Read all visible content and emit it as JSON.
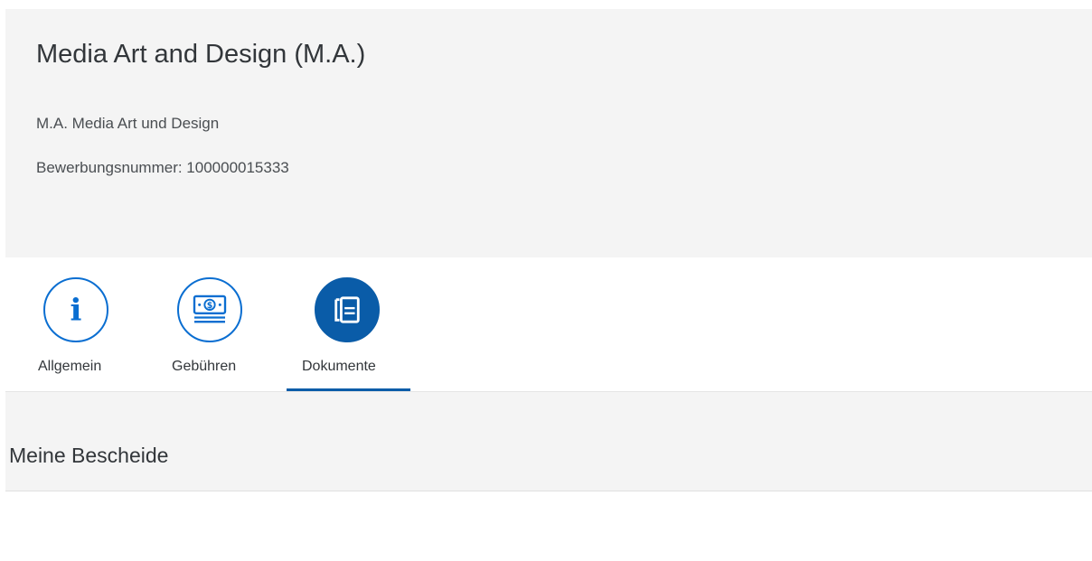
{
  "header": {
    "title": "Media Art and Design (M.A.)",
    "subtitle": "M.A. Media Art und Design",
    "application_number": "Bewerbungsnummer: 100000015333"
  },
  "tabs": [
    {
      "label": "Allgemein",
      "icon": "info-icon",
      "active": false
    },
    {
      "label": "Gebühren",
      "icon": "money-bill-icon",
      "active": false
    },
    {
      "label": "Dokumente",
      "icon": "documents-icon",
      "active": true
    }
  ],
  "section": {
    "title": "Meine Bescheide"
  },
  "colors": {
    "accent": "#0a5ca8",
    "icon_outline": "#0a6ed1",
    "header_bg": "#f4f4f4",
    "text": "#32363a"
  }
}
